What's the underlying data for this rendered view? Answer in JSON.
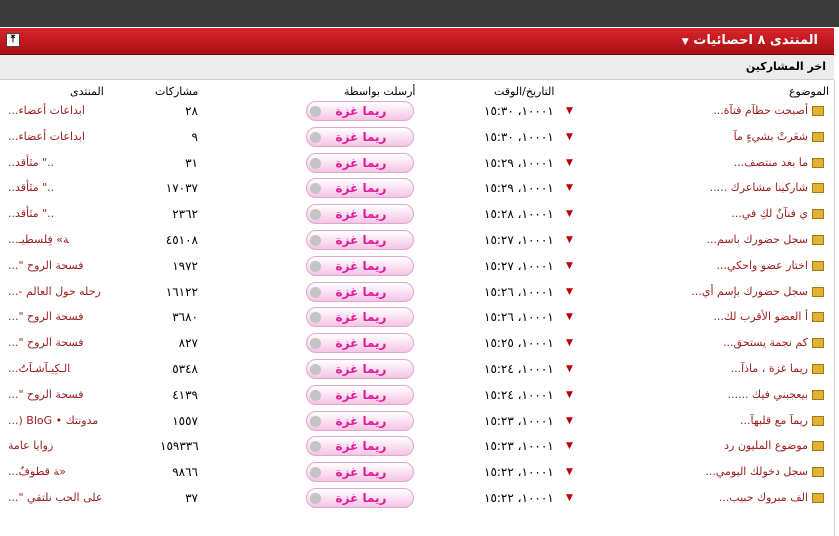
{
  "header": {
    "title": "المنتدى ٨ احصائيات",
    "toggle_glyph": "⤒"
  },
  "subheader": {
    "label": "اخر المشاركين"
  },
  "columns": {
    "topic": "الموضوع",
    "date": "التاريخ/الوقت",
    "poster": "أرسلت بواسطة",
    "replies": "مشاركات",
    "forum": "المنتدى"
  },
  "rows": [
    {
      "topic": "أصبحت حطآم فتآة...",
      "date": "١٠٠٠١، ١٥:٣٠",
      "poster": "ريما غزة",
      "replies": "٢٨",
      "forum": "ابداعات أعضاء..."
    },
    {
      "topic": "شعَرتْ بشيءٍ مآ",
      "date": "١٠٠٠١، ١٥:٣٠",
      "poster": "ريما غزة",
      "replies": "٩",
      "forum": "ابداعات أعضاء..."
    },
    {
      "topic": "ما بعد منتصف...",
      "date": "١٠٠٠١، ١٥:٢٩",
      "poster": "ريما غزة",
      "replies": "٣١",
      "forum": "..\" مٿأقد.."
    },
    {
      "topic": "شاركينا مشاعرك .....",
      "date": "١٠٠٠١، ١٥:٢٩",
      "poster": "ريما غزة",
      "replies": "١٧٠٣٧",
      "forum": "..\" مٿأقد.."
    },
    {
      "topic": "ي فنآنٌ لكِ في...",
      "date": "١٠٠٠١، ١٥:٢٨",
      "poster": "ريما غزة",
      "replies": "٢٣٦٢",
      "forum": "..\" مٿأقد.."
    },
    {
      "topic": "سجل حضورك باسم...",
      "date": "١٠٠٠١، ١٥:٢٧",
      "poster": "ريما غزة",
      "replies": "٤٥١٠٨",
      "forum": "ﺔ» فِلسطيـ..."
    },
    {
      "topic": "اختار عضو واحكي...",
      "date": "١٠٠٠١، ١٥:٢٧",
      "poster": "ريما غزة",
      "replies": "١٩٧٢",
      "forum": "فسحة الروح \"..."
    },
    {
      "topic": "سجل حضورك بإسم أي...",
      "date": "١٠٠٠١، ١٥:٢٦",
      "poster": "ريما غزة",
      "replies": "١٦١٢٢",
      "forum": "رحله حول العالم -..."
    },
    {
      "topic": "أ العضو الأقرب لك...",
      "date": "١٠٠٠١، ١٥:٢٦",
      "poster": "ريما غزة",
      "replies": "٣٦٨٠",
      "forum": "فسحة الروح \"..."
    },
    {
      "topic": "كم نجمة يستحق...",
      "date": "١٠٠٠١، ١٥:٢٥",
      "poster": "ريما غزة",
      "replies": "٨٢٧",
      "forum": "فسحة الروح \"..."
    },
    {
      "topic": "ريما غزة ، ماذآ...",
      "date": "١٠٠٠١، ١٥:٢٤",
      "poster": "ريما غزة",
      "replies": "٥٣٤٨",
      "forum": "الـكِيـآشـآتُ..."
    },
    {
      "topic": "بيعجبني فيك ......",
      "date": "١٠٠٠١، ١٥:٢٤",
      "poster": "ريما غزة",
      "replies": "٤١٣٩",
      "forum": "فسحة الروح \"..."
    },
    {
      "topic": "ريمآ مع قلبهآ...",
      "date": "١٠٠٠١، ١٥:٢٣",
      "poster": "ريما غزة",
      "replies": "١٥٥٧",
      "forum": "مدونتك • BloG (..."
    },
    {
      "topic": "موضوع المليون رد",
      "date": "١٠٠٠١، ١٥:٢٣",
      "poster": "ريما غزة",
      "replies": "١٥٩٣٣٦",
      "forum": "زوايا عامة"
    },
    {
      "topic": "سجل دخولك اليومي...",
      "date": "١٠٠٠١، ١٥:٢٢",
      "poster": "ريما غزة",
      "replies": "٩٨٦٦",
      "forum": "«ﺔ قطوفٌ..."
    },
    {
      "topic": "الف مبروك حبيب...",
      "date": "١٠٠٠١، ١٥:٢٢",
      "poster": "ريما غزة",
      "replies": "٣٧",
      "forum": "على الحب نلتقي \"..."
    }
  ]
}
